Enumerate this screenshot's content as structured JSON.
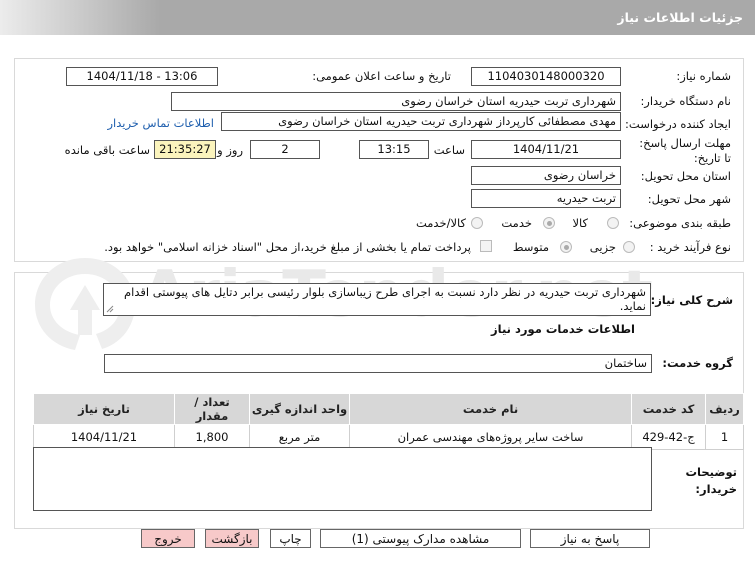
{
  "header": {
    "title": "جزئیات اطلاعات نیاز"
  },
  "watermark": {
    "text": "AriaTender.net"
  },
  "fields": {
    "need_number_label": "شماره نیاز:",
    "need_number": "1104030148000320",
    "announce_label": "تاریخ و ساعت اعلان عمومی:",
    "announce_value": "1404/11/18 - 13:06",
    "buyer_org_label": "نام دستگاه خریدار:",
    "buyer_org": "شهرداری تربت حیدریه استان خراسان رضوی",
    "requester_label": "ایجاد کننده درخواست:",
    "requester": "مهدی مصطفائی کارپرداز شهرداری تربت حیدریه استان خراسان رضوی",
    "contact_link": "اطلاعات تماس خریدار",
    "deadline_label": "مهلت ارسال پاسخ: تا تاریخ:",
    "deadline_date": "1404/11/21",
    "time_label": "ساعت",
    "deadline_time": "13:15",
    "days_value": "2",
    "days_label": "روز و",
    "remaining_time": "21:35:27",
    "remaining_label": "ساعت باقی مانده",
    "province_label": "استان محل تحویل:",
    "province": "خراسان رضوی",
    "city_label": "شهر محل تحویل:",
    "city": "تربت حیدریه",
    "category_label": "طبقه بندی موضوعی:",
    "category_options": [
      "کالا",
      "خدمت",
      "کالا/خدمت"
    ],
    "process_label": "نوع فرآیند خرید :",
    "process_options": [
      "جزیی",
      "متوسط"
    ],
    "payment_note": "پرداخت تمام یا بخشی از مبلغ خرید،از محل \"اسناد خزانه اسلامی\" خواهد بود."
  },
  "description": {
    "label": "شرح کلی نیاز:",
    "text": "شهرداری تربت حیدریه در نظر دارد نسبت به اجرای طرح زیباسازی بلوار رئیسی برابر دتایل های پیوستی اقدام نماید."
  },
  "services": {
    "section_title": "اطلاعات خدمات مورد نیاز",
    "group_label": "گروه خدمت:",
    "group_value": "ساختمان"
  },
  "table": {
    "headers": [
      "ردیف",
      "کد خدمت",
      "نام خدمت",
      "واحد اندازه گیری",
      "تعداد / مقدار",
      "تاریخ نیاز"
    ],
    "rows": [
      [
        "1",
        "ج-42-429",
        "ساخت سایر پروژه‌های مهندسی عمران",
        "متر مربع",
        "1,800",
        "1404/11/21"
      ]
    ]
  },
  "buyer_notes": {
    "label_line1": "توضیحات",
    "label_line2": "خریدار:",
    "value": ""
  },
  "buttons": {
    "reply": "پاسخ به نیاز",
    "attachments": "مشاهده مدارک پیوستی (1)",
    "print": "چاپ",
    "back": "بازگشت",
    "exit": "خروج"
  },
  "colors": {
    "header_bg": "#a9a9a9",
    "link": "#1f5fae",
    "remaining_bg": "#fbf4bd",
    "pink_button": "#f7c9c9"
  }
}
